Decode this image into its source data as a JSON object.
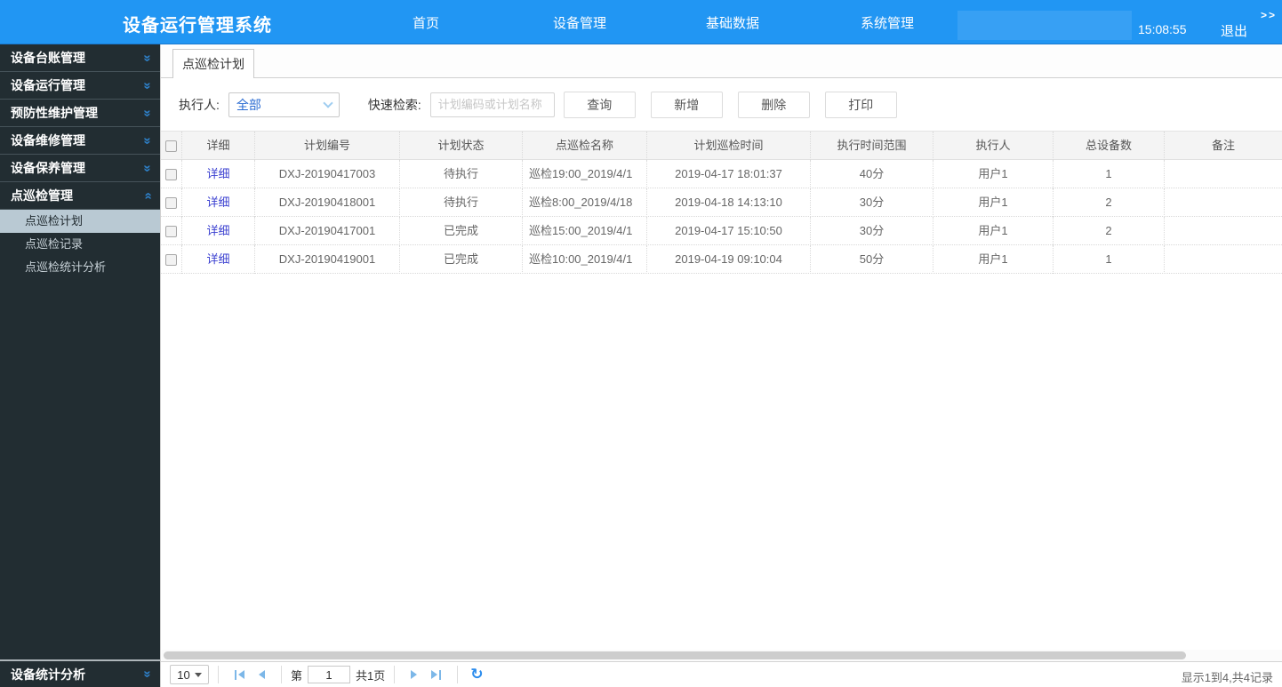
{
  "app": {
    "title": "设备运行管理系统",
    "time": "15:08:55",
    "logout_label": "退出"
  },
  "icons": {
    "chevron_double": "»",
    "refresh": "↻",
    "expand_arrows": ">>"
  },
  "topnav": {
    "items": [
      "首页",
      "设备管理",
      "基础数据",
      "系统管理"
    ]
  },
  "sidebar": {
    "groups": [
      {
        "label": "设备台账管理",
        "state": "collapsed"
      },
      {
        "label": "设备运行管理",
        "state": "collapsed"
      },
      {
        "label": "预防性维护管理",
        "state": "collapsed"
      },
      {
        "label": "设备维修管理",
        "state": "collapsed"
      },
      {
        "label": "设备保养管理",
        "state": "collapsed"
      },
      {
        "label": "点巡检管理",
        "state": "expanded",
        "children": [
          {
            "label": "点巡检计划",
            "selected": true
          },
          {
            "label": "点巡检记录",
            "selected": false
          },
          {
            "label": "点巡检统计分析",
            "selected": false
          }
        ]
      },
      {
        "label": "设备统计分析",
        "state": "collapsed"
      }
    ]
  },
  "tab": {
    "label": "点巡检计划"
  },
  "filters": {
    "executor_label": "执行人:",
    "executor_value": "全部",
    "search_label": "快速检索:",
    "search_placeholder": "计划编码或计划名称",
    "buttons": {
      "query": "查询",
      "add": "新增",
      "delete": "删除",
      "print": "打印"
    }
  },
  "table": {
    "columns": [
      "详细",
      "计划编号",
      "计划状态",
      "点巡检名称",
      "计划巡检时间",
      "执行时间范围",
      "执行人",
      "总设备数",
      "备注"
    ],
    "rows": [
      {
        "detail": "详细",
        "plan_no": "DXJ-20190417003",
        "status": "待执行",
        "name": "巡检19:00_2019/4/1",
        "time": "2019-04-17 18:01:37",
        "range": "40分",
        "executor": "用户1",
        "devices": "1",
        "remark": ""
      },
      {
        "detail": "详细",
        "plan_no": "DXJ-20190418001",
        "status": "待执行",
        "name": "巡检8:00_2019/4/18",
        "time": "2019-04-18 14:13:10",
        "range": "30分",
        "executor": "用户1",
        "devices": "2",
        "remark": ""
      },
      {
        "detail": "详细",
        "plan_no": "DXJ-20190417001",
        "status": "已完成",
        "name": "巡检15:00_2019/4/1",
        "time": "2019-04-17 15:10:50",
        "range": "30分",
        "executor": "用户1",
        "devices": "2",
        "remark": ""
      },
      {
        "detail": "详细",
        "plan_no": "DXJ-20190419001",
        "status": "已完成",
        "name": "巡检10:00_2019/4/1",
        "time": "2019-04-19 09:10:04",
        "range": "50分",
        "executor": "用户1",
        "devices": "1",
        "remark": ""
      }
    ]
  },
  "pagination": {
    "page_size": "10",
    "page_prefix": "第",
    "page": "1",
    "total_pages": "共1页",
    "summary": "显示1到4,共4记录"
  },
  "colors": {
    "topbar": "#2196f3",
    "sidebar": "#222d32",
    "selected_subitem": "#b9c9d3",
    "link": "#3a3fd0",
    "accent_blue": "#2b8ced"
  }
}
